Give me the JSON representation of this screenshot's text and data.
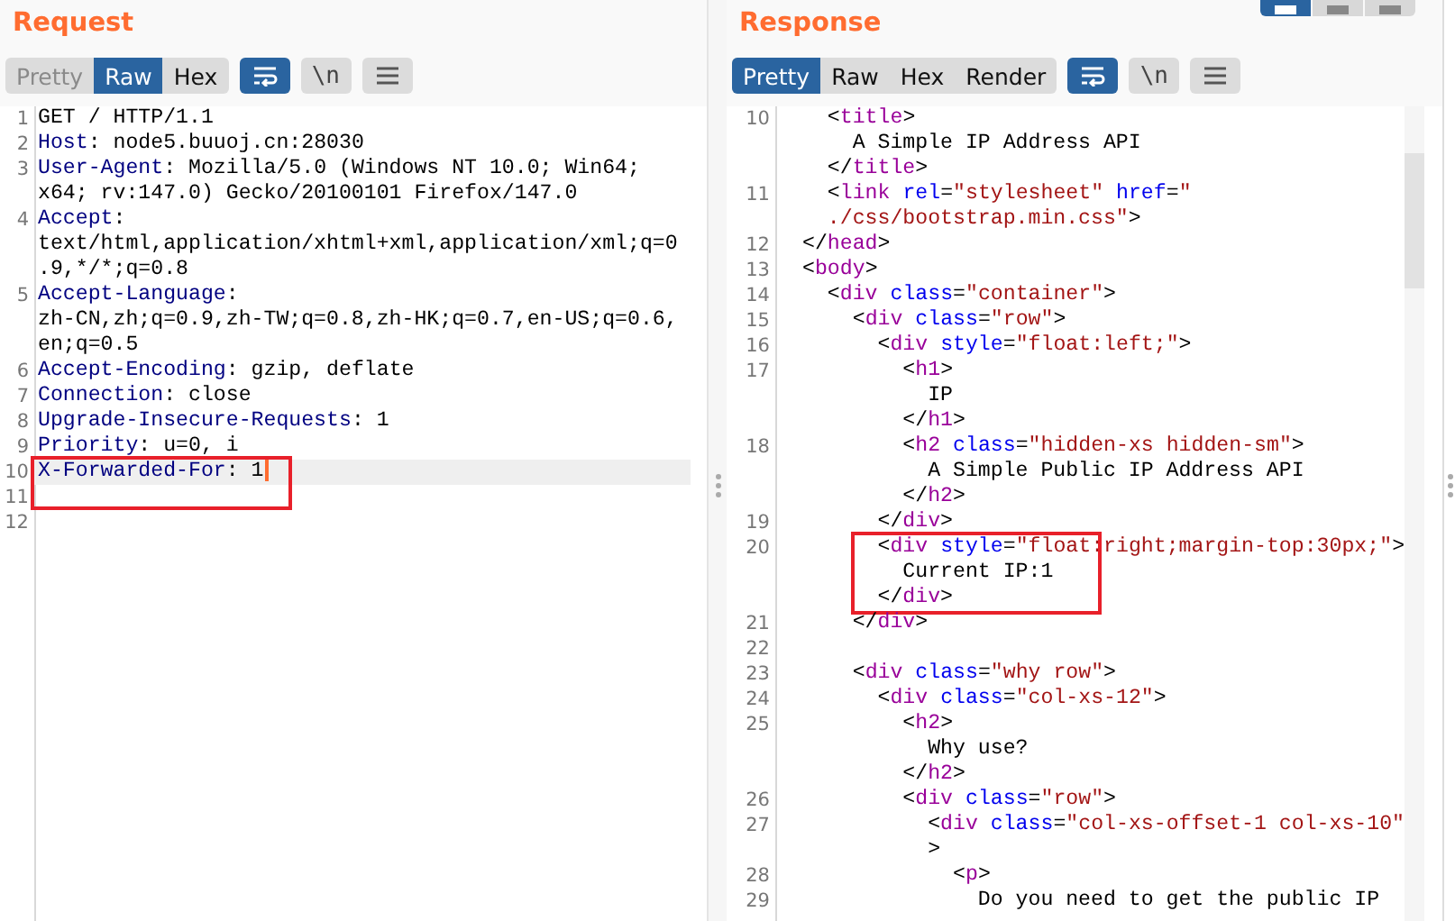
{
  "layout_toggle": [
    {
      "selected": true
    },
    {
      "selected": false
    },
    {
      "selected": false
    }
  ],
  "panes": [
    {
      "title": "Request",
      "kind": "http",
      "tabs": [
        {
          "label": "Pretty",
          "selected": false,
          "disabled": true
        },
        {
          "label": "Raw",
          "selected": true,
          "disabled": false
        },
        {
          "label": "Hex",
          "selected": false,
          "disabled": false
        }
      ],
      "tools": [
        {
          "kind": "wrap",
          "on": true
        },
        {
          "kind": "newline",
          "text": "\\n",
          "on": false
        },
        {
          "kind": "menu",
          "on": false
        }
      ],
      "lines": [
        {
          "number": "1",
          "rows": [
            "GET / HTTP/1.1"
          ]
        },
        {
          "number": "2",
          "rows": [
            "Host: node5.buuoj.cn:28030"
          ]
        },
        {
          "number": "3",
          "rows": [
            "User-Agent: Mozilla/5.0 (Windows NT 10.0; Win64;",
            "x64; rv:147.0) Gecko/20100101 Firefox/147.0"
          ]
        },
        {
          "number": "4",
          "rows": [
            "Accept:",
            "text/html,application/xhtml+xml,application/xml;q=0",
            ".9,*/*;q=0.8"
          ]
        },
        {
          "number": "5",
          "rows": [
            "Accept-Language:",
            "zh-CN,zh;q=0.9,zh-TW;q=0.8,zh-HK;q=0.7,en-US;q=0.6,",
            "en;q=0.5"
          ]
        },
        {
          "number": "6",
          "rows": [
            "Accept-Encoding: gzip, deflate"
          ]
        },
        {
          "number": "7",
          "rows": [
            "Connection: close"
          ]
        },
        {
          "number": "8",
          "rows": [
            "Upgrade-Insecure-Requests: 1"
          ]
        },
        {
          "number": "9",
          "rows": [
            "Priority: u=0, i"
          ]
        },
        {
          "number": "10",
          "current": true,
          "caret": true,
          "boxed": true,
          "rows": [
            "X-Forwarded-For: 1"
          ]
        },
        {
          "number": "11"
        },
        {
          "number": "12"
        }
      ]
    },
    {
      "title": "Response",
      "kind": "html",
      "scrollbar": true,
      "tabs": [
        {
          "label": "Pretty",
          "selected": true,
          "disabled": false
        },
        {
          "label": "Raw",
          "selected": false,
          "disabled": false
        },
        {
          "label": "Hex",
          "selected": false,
          "disabled": false
        },
        {
          "label": "Render",
          "selected": false,
          "disabled": false
        }
      ],
      "tools": [
        {
          "kind": "wrap",
          "on": true
        },
        {
          "kind": "newline",
          "text": "\\n",
          "on": false
        },
        {
          "kind": "menu",
          "on": false
        }
      ],
      "lines": [
        {
          "number": "10",
          "rows": [
            "  <title>",
            "    A Simple IP Address API",
            "  </title>"
          ]
        },
        {
          "number": "11",
          "rows": [
            "  <link rel=\"stylesheet\" href=\"",
            "  ./css/bootstrap.min.css\">"
          ]
        },
        {
          "number": "12",
          "rows": [
            "</head>"
          ]
        },
        {
          "number": "13",
          "rows": [
            "<body>"
          ]
        },
        {
          "number": "14",
          "rows": [
            "  <div class=\"container\">"
          ]
        },
        {
          "number": "15",
          "rows": [
            "    <div class=\"row\">"
          ]
        },
        {
          "number": "16",
          "rows": [
            "      <div style=\"float:left;\">"
          ]
        },
        {
          "number": "17",
          "rows": [
            "        <h1>",
            "          IP",
            "        </h1>"
          ]
        },
        {
          "number": "18",
          "rows": [
            "        <h2 class=\"hidden-xs hidden-sm\">",
            "          A Simple Public IP Address API",
            "        </h2>"
          ]
        },
        {
          "number": "19",
          "rows": [
            "      </div>"
          ]
        },
        {
          "number": "20",
          "boxed": true,
          "rows": [
            "      <div style=\"float:right;margin-top:30px;\">",
            "        Current IP:1",
            "      </div>"
          ]
        },
        {
          "number": "21",
          "rows": [
            "    </div>"
          ]
        },
        {
          "number": "22"
        },
        {
          "number": "23",
          "rows": [
            "    <div class=\"why row\">"
          ]
        },
        {
          "number": "24",
          "rows": [
            "      <div class=\"col-xs-12\">"
          ]
        },
        {
          "number": "25",
          "rows": [
            "        <h2>",
            "          Why use?",
            "        </h2>"
          ]
        },
        {
          "number": "26",
          "rows": [
            "        <div class=\"row\">"
          ]
        },
        {
          "number": "27",
          "rows": [
            "          <div class=\"col-xs-offset-1 col-xs-10\"",
            "          >"
          ]
        },
        {
          "number": "28",
          "rows": [
            "            <p>"
          ]
        },
        {
          "number": "29",
          "rows": [
            "              Do you need to get the public IP"
          ]
        }
      ]
    }
  ]
}
